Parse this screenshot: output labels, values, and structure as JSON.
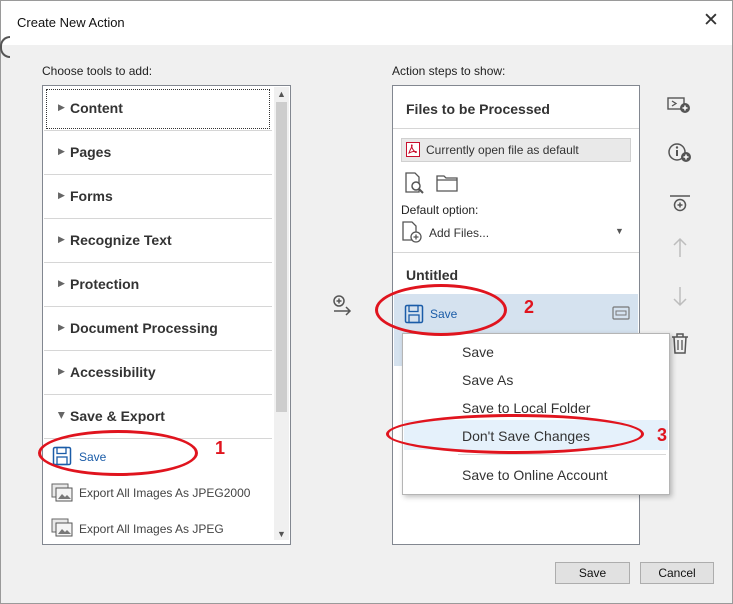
{
  "window": {
    "title": "Create New Action",
    "close_glyph": "✕"
  },
  "left": {
    "label": "Choose tools to add:",
    "groups": [
      "Content",
      "Pages",
      "Forms",
      "Recognize Text",
      "Protection",
      "Document Processing",
      "Accessibility",
      "Save & Export"
    ],
    "items": [
      "Save",
      "Export All Images As JPEG2000",
      "Export All Images As JPEG"
    ]
  },
  "right": {
    "label": "Action steps to show:",
    "files_heading": "Files to be Processed",
    "current_file": "Currently open file as default",
    "default_option_label": "Default option:",
    "add_files": "Add Files...",
    "untitled": "Untitled",
    "step_save": "Save"
  },
  "context_menu": {
    "items": [
      "Save",
      "Save As",
      "Save to Local Folder",
      "Don't Save Changes",
      "Save to Online Account"
    ],
    "highlighted": "Don't Save Changes"
  },
  "annotations": [
    "1",
    "2",
    "3"
  ],
  "buttons": {
    "save": "Save",
    "cancel": "Cancel"
  },
  "colors": {
    "accent_blue": "#1a5ca8",
    "annotation_red": "#e0141e",
    "pdf_red": "#c8102e",
    "menu_highlight": "#e5f1fb",
    "step_selected": "#d5e2ef"
  }
}
